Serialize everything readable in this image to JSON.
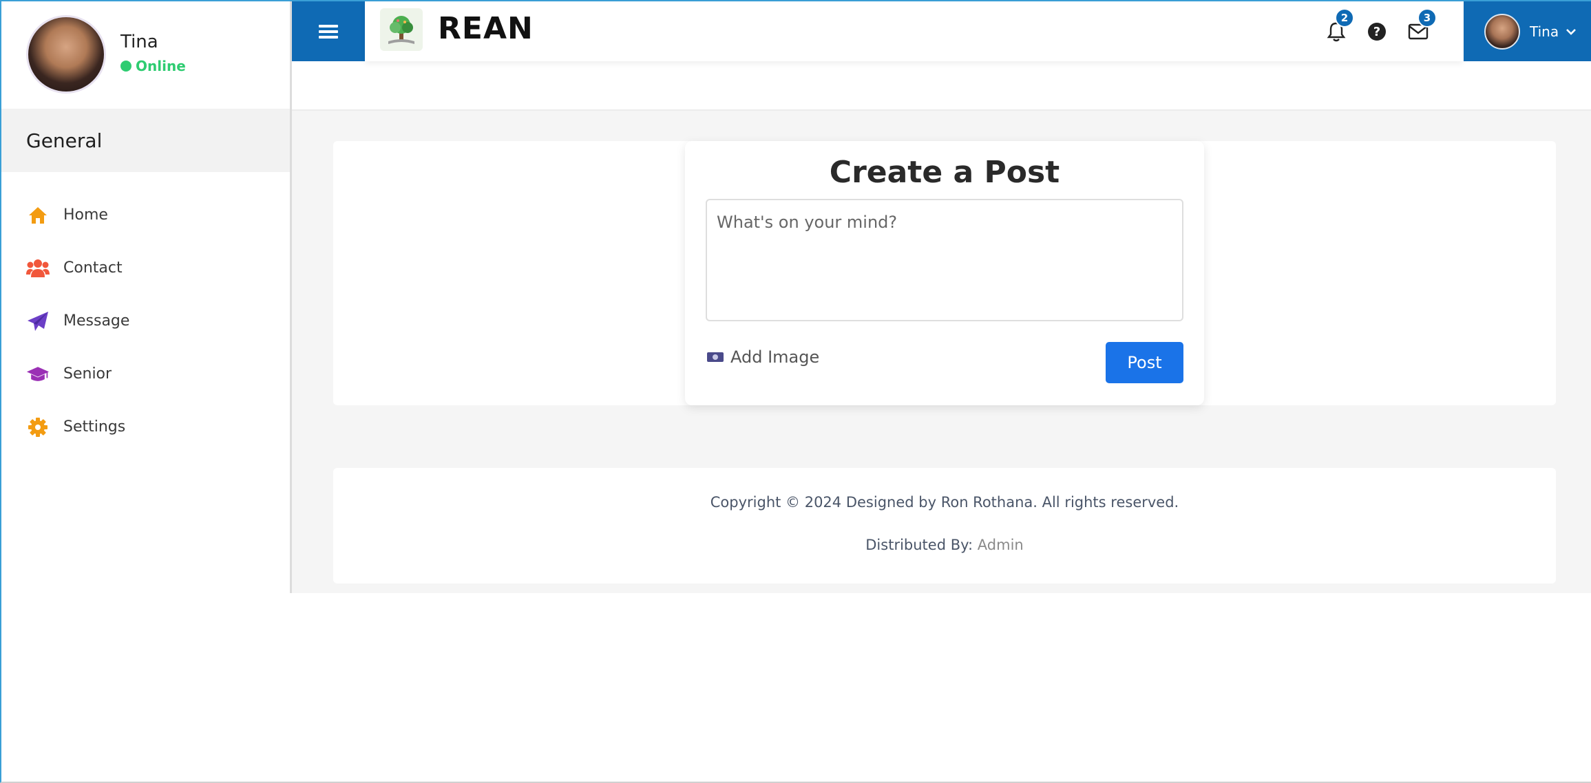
{
  "sidebar": {
    "user_name": "Tina",
    "status": "Online",
    "section_title": "General",
    "items": [
      {
        "label": "Home",
        "icon": "home-icon",
        "color": "#f39c12"
      },
      {
        "label": "Contact",
        "icon": "users-icon",
        "color": "#f1573b"
      },
      {
        "label": "Message",
        "icon": "paper-plane-icon",
        "color": "#6c3fc7"
      },
      {
        "label": "Senior",
        "icon": "graduation-cap-icon",
        "color": "#9b30b5"
      },
      {
        "label": "Settings",
        "icon": "gear-icon",
        "color": "#f39c12"
      }
    ]
  },
  "header": {
    "brand": "REAN",
    "notifications_count": "2",
    "messages_count": "3",
    "user_name": "Tina"
  },
  "post": {
    "title": "Create a Post",
    "placeholder": "What's on your mind?",
    "add_image_label": "Add Image",
    "post_button": "Post"
  },
  "footer": {
    "copyright": "Copyright © 2024 Designed by Ron Rothana. All rights reserved.",
    "distributed_prefix": "Distributed By: ",
    "distributed_by": "Admin"
  },
  "colors": {
    "primary": "#0f6ab4",
    "button": "#1a73e8",
    "online": "#2ecc71"
  }
}
